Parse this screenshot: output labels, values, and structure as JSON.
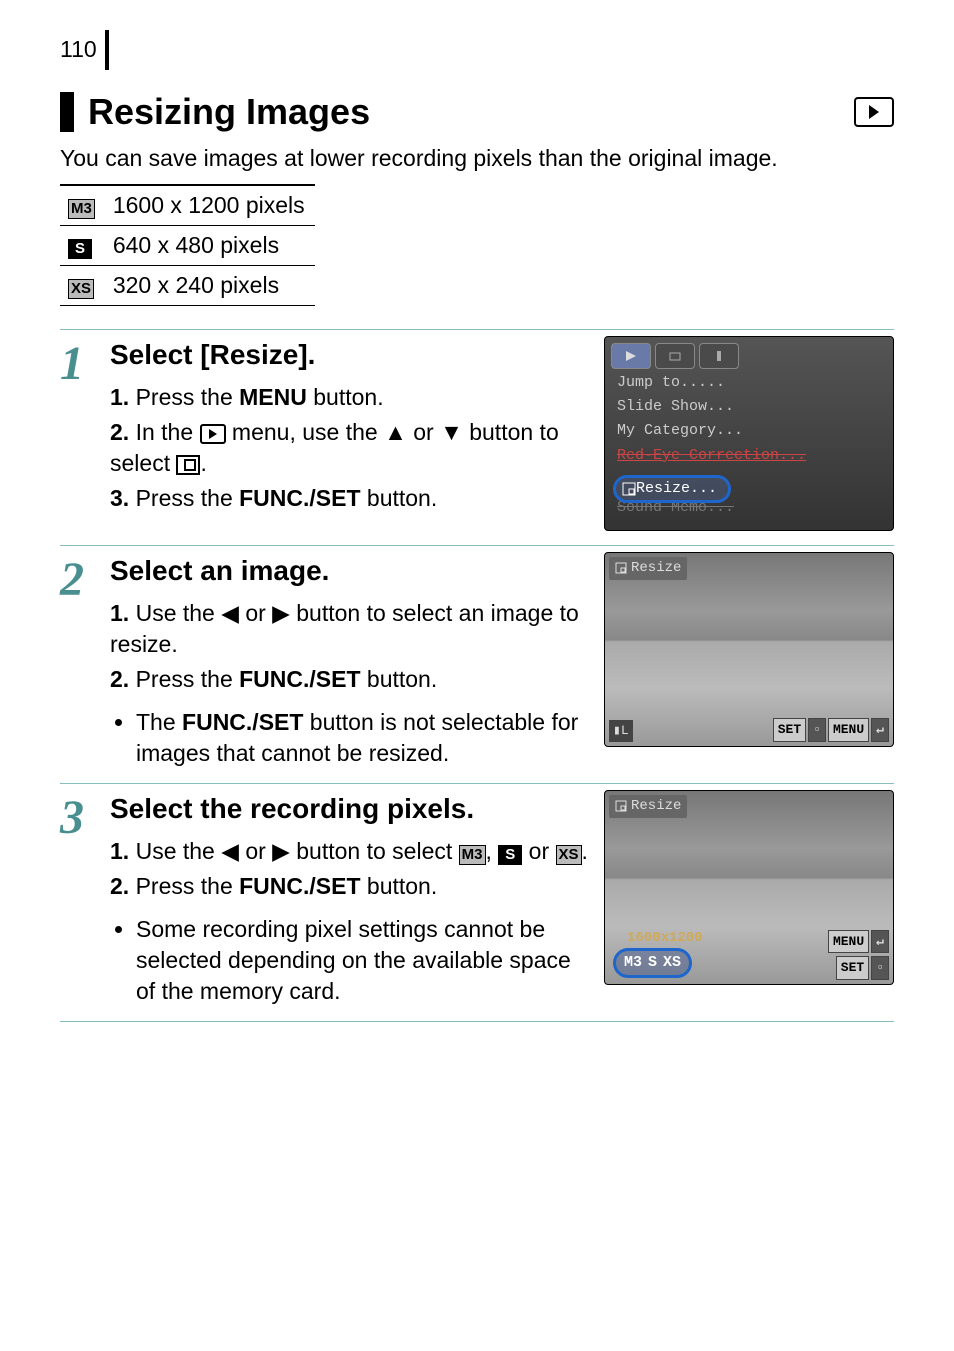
{
  "page_number": "110",
  "title": "Resizing Images",
  "intro": "You can save images at lower recording pixels than the original image.",
  "pixel_options": [
    {
      "badge": "M3",
      "badge_style": "gray",
      "text": "1600 x 1200 pixels"
    },
    {
      "badge": "S",
      "badge_style": "dark",
      "text": "640 x 480 pixels"
    },
    {
      "badge": "XS",
      "badge_style": "gray",
      "text": "320 x 240 pixels"
    }
  ],
  "steps": {
    "1": {
      "num": "1",
      "title": "Select [Resize].",
      "items": {
        "1": {
          "num": "1.",
          "pre": "Press the ",
          "strong": "MENU",
          "post": " button."
        },
        "2": {
          "num": "2.",
          "text_a": "In the ",
          "text_b": " menu, use the ",
          "text_c": " or ",
          "text_d": " button to select ",
          "text_e": "."
        },
        "3": {
          "num": "3.",
          "pre": "Press the ",
          "strong": "FUNC./SET",
          "post": " button."
        }
      },
      "screen": {
        "menu_items": {
          "jump": "Jump to.....",
          "slide": "Slide Show...",
          "cat": "My Category...",
          "red": "Red-Eye Correction...",
          "resize": "Resize...",
          "sound": "Sound Memo..."
        }
      }
    },
    "2": {
      "num": "2",
      "title": "Select an image.",
      "items": {
        "1": {
          "num": "1.",
          "text_a": "Use the ",
          "text_b": " or ",
          "text_c": " button to select an image to resize."
        },
        "2": {
          "num": "2.",
          "pre": "Press the ",
          "strong": "FUNC./SET",
          "post": " button."
        }
      },
      "bullets": {
        "0": {
          "text_a": "The ",
          "strong": "FUNC./SET",
          "text_b": " button is not selectable for images that cannot be resized."
        }
      },
      "screen": {
        "label": "Resize",
        "set": "SET",
        "menu": "MENU"
      }
    },
    "3": {
      "num": "3",
      "title": "Select the recording pixels.",
      "items": {
        "1": {
          "num": "1.",
          "text_a": "Use the ",
          "text_b": " or ",
          "text_c": " button to select ",
          "text_d": ", ",
          "text_e": " or ",
          "text_f": "."
        },
        "2": {
          "num": "2.",
          "pre": "Press the ",
          "strong": "FUNC./SET",
          "post": " button."
        }
      },
      "bullets": {
        "0": "Some recording pixel settings cannot be selected depending on the available space of the memory card."
      },
      "screen": {
        "label": "Resize",
        "size_text": "1600x1200",
        "opts": {
          "a": "M3",
          "b": "S",
          "c": "XS"
        },
        "menu": "MENU",
        "set": "SET"
      }
    }
  }
}
